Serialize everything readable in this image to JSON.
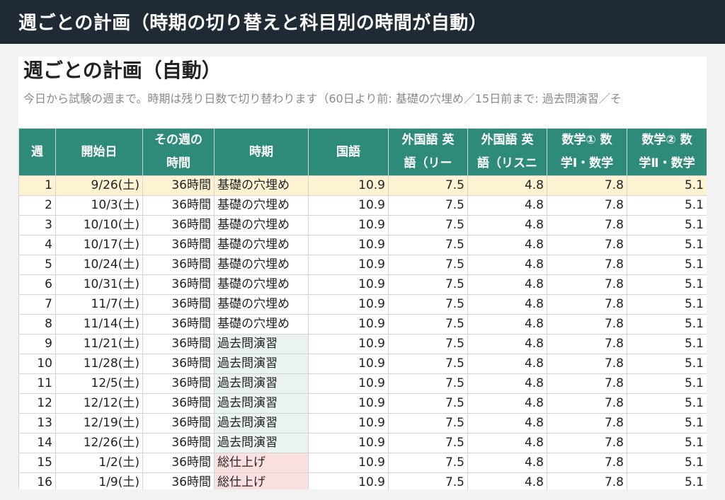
{
  "topbar": {
    "title": "週ごとの計画（時期の切り替えと科目別の時間が自動）"
  },
  "sheet": {
    "title": "週ごとの計画（自動）",
    "subtitle": "今日から試験の週まで。時期は残り日数で切り替わります（60日より前: 基礎の穴埋め／15日前まで: 過去問演習／そ",
    "headers": {
      "week": "週",
      "start": "開始日",
      "hours_l1": "その週の",
      "hours_l2": "時間",
      "phase": "時期",
      "kokugo": "国語",
      "eng_r_l1": "外国語 英",
      "eng_r_l2": "語（リー",
      "eng_l_l1": "外国語 英",
      "eng_l_l2": "語（リスニ",
      "math1_l1": "数学① 数",
      "math1_l2": "学Ⅰ・数学",
      "math2_l1": "数学② 数",
      "math2_l2": "学Ⅱ・数学"
    },
    "rows": [
      {
        "week": "1",
        "start": "9/26(土)",
        "hours": "36時間",
        "phase": "基礎の穴埋め",
        "kokugo": "10.9",
        "eng_r": "7.5",
        "eng_l": "4.8",
        "math1": "7.8",
        "math2": "5.1"
      },
      {
        "week": "2",
        "start": "10/3(土)",
        "hours": "36時間",
        "phase": "基礎の穴埋め",
        "kokugo": "10.9",
        "eng_r": "7.5",
        "eng_l": "4.8",
        "math1": "7.8",
        "math2": "5.1"
      },
      {
        "week": "3",
        "start": "10/10(土)",
        "hours": "36時間",
        "phase": "基礎の穴埋め",
        "kokugo": "10.9",
        "eng_r": "7.5",
        "eng_l": "4.8",
        "math1": "7.8",
        "math2": "5.1"
      },
      {
        "week": "4",
        "start": "10/17(土)",
        "hours": "36時間",
        "phase": "基礎の穴埋め",
        "kokugo": "10.9",
        "eng_r": "7.5",
        "eng_l": "4.8",
        "math1": "7.8",
        "math2": "5.1"
      },
      {
        "week": "5",
        "start": "10/24(土)",
        "hours": "36時間",
        "phase": "基礎の穴埋め",
        "kokugo": "10.9",
        "eng_r": "7.5",
        "eng_l": "4.8",
        "math1": "7.8",
        "math2": "5.1"
      },
      {
        "week": "6",
        "start": "10/31(土)",
        "hours": "36時間",
        "phase": "基礎の穴埋め",
        "kokugo": "10.9",
        "eng_r": "7.5",
        "eng_l": "4.8",
        "math1": "7.8",
        "math2": "5.1"
      },
      {
        "week": "7",
        "start": "11/7(土)",
        "hours": "36時間",
        "phase": "基礎の穴埋め",
        "kokugo": "10.9",
        "eng_r": "7.5",
        "eng_l": "4.8",
        "math1": "7.8",
        "math2": "5.1"
      },
      {
        "week": "8",
        "start": "11/14(土)",
        "hours": "36時間",
        "phase": "基礎の穴埋め",
        "kokugo": "10.9",
        "eng_r": "7.5",
        "eng_l": "4.8",
        "math1": "7.8",
        "math2": "5.1"
      },
      {
        "week": "9",
        "start": "11/21(土)",
        "hours": "36時間",
        "phase": "過去問演習",
        "kokugo": "10.9",
        "eng_r": "7.5",
        "eng_l": "4.8",
        "math1": "7.8",
        "math2": "5.1"
      },
      {
        "week": "10",
        "start": "11/28(土)",
        "hours": "36時間",
        "phase": "過去問演習",
        "kokugo": "10.9",
        "eng_r": "7.5",
        "eng_l": "4.8",
        "math1": "7.8",
        "math2": "5.1"
      },
      {
        "week": "11",
        "start": "12/5(土)",
        "hours": "36時間",
        "phase": "過去問演習",
        "kokugo": "10.9",
        "eng_r": "7.5",
        "eng_l": "4.8",
        "math1": "7.8",
        "math2": "5.1"
      },
      {
        "week": "12",
        "start": "12/12(土)",
        "hours": "36時間",
        "phase": "過去問演習",
        "kokugo": "10.9",
        "eng_r": "7.5",
        "eng_l": "4.8",
        "math1": "7.8",
        "math2": "5.1"
      },
      {
        "week": "13",
        "start": "12/19(土)",
        "hours": "36時間",
        "phase": "過去問演習",
        "kokugo": "10.9",
        "eng_r": "7.5",
        "eng_l": "4.8",
        "math1": "7.8",
        "math2": "5.1"
      },
      {
        "week": "14",
        "start": "12/26(土)",
        "hours": "36時間",
        "phase": "過去問演習",
        "kokugo": "10.9",
        "eng_r": "7.5",
        "eng_l": "4.8",
        "math1": "7.8",
        "math2": "5.1"
      },
      {
        "week": "15",
        "start": "1/2(土)",
        "hours": "36時間",
        "phase": "総仕上げ",
        "kokugo": "10.9",
        "eng_r": "7.5",
        "eng_l": "4.8",
        "math1": "7.8",
        "math2": "5.1"
      },
      {
        "week": "16",
        "start": "1/9(土)",
        "hours": "36時間",
        "phase": "総仕上げ",
        "kokugo": "10.9",
        "eng_r": "7.5",
        "eng_l": "4.8",
        "math1": "7.8",
        "math2": "5.1"
      }
    ]
  },
  "colors": {
    "topbar_bg": "#202a35",
    "header_bg": "#2e8b7a",
    "highlight_row": "#fdf3d2",
    "phase_past_exam": "#eaf3f0",
    "phase_final": "#fbe0e2"
  }
}
